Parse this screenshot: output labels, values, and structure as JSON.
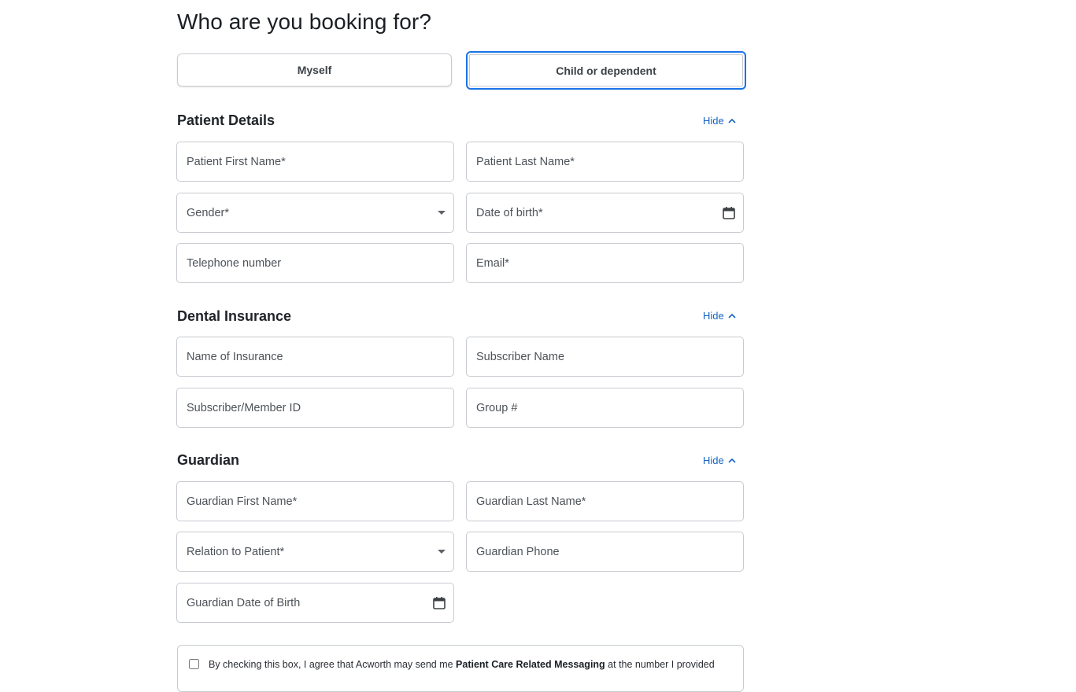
{
  "heading": "Who are you booking for?",
  "booking_options": {
    "myself": "Myself",
    "child": "Child or dependent",
    "selected": "Child or dependent"
  },
  "hide_label": "Hide",
  "colors": {
    "accent": "#1a73e8",
    "link": "#1565c0",
    "border": "#c7cbd0"
  },
  "patient_details": {
    "title": "Patient Details",
    "first_name": "Patient First Name*",
    "last_name": "Patient Last Name*",
    "gender": "Gender*",
    "dob": "Date of birth*",
    "phone": "Telephone number",
    "email": "Email*"
  },
  "dental_insurance": {
    "title": "Dental Insurance",
    "insurance_name": "Name of Insurance",
    "subscriber_name": "Subscriber Name",
    "member_id": "Subscriber/Member ID",
    "group": "Group #"
  },
  "guardian": {
    "title": "Guardian",
    "first_name": "Guardian First Name*",
    "last_name": "Guardian Last Name*",
    "relation": "Relation to Patient*",
    "phone": "Guardian Phone",
    "dob": "Guardian Date of Birth"
  },
  "consent": {
    "prefix": "By checking this box, I agree that Acworth may send me ",
    "bold": "Patient Care Related Messaging",
    "suffix": " at the number I provided"
  },
  "icons": {
    "dropdown": "caret-down-icon",
    "calendar": "calendar-icon",
    "hide": "chevron-up-icon"
  }
}
